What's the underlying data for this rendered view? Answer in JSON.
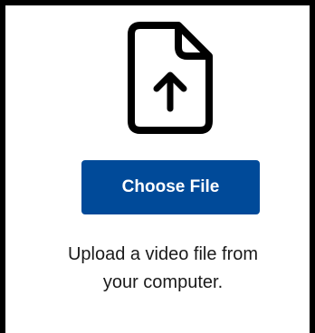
{
  "upload": {
    "icon": "file-upload-icon",
    "button_label": "Choose File",
    "help_line_1": "Upload a video file from",
    "help_line_2": "your computer."
  },
  "colors": {
    "button_background": "#004a99",
    "button_text": "#ffffff",
    "border": "#000000",
    "text": "#1a1a1a"
  }
}
